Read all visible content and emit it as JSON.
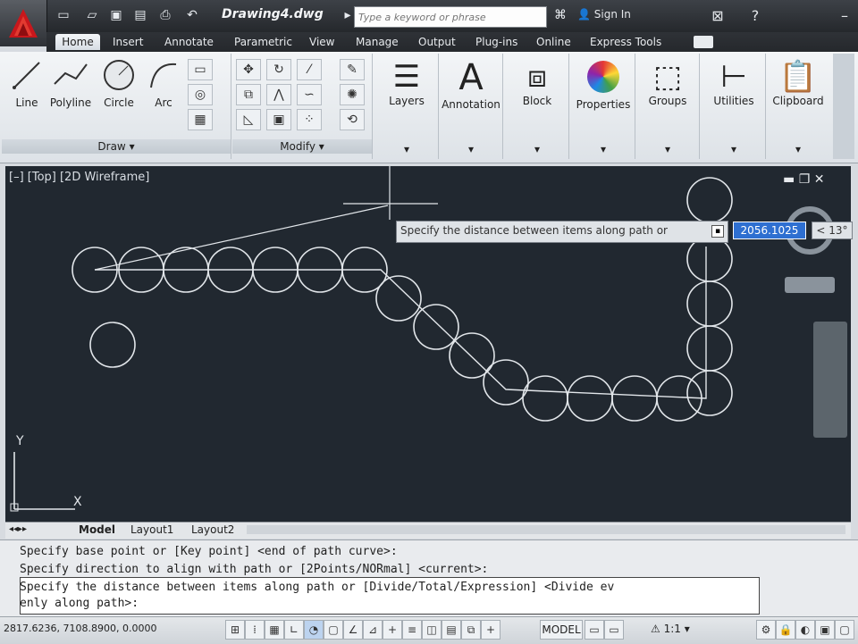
{
  "window": {
    "doc_title": "Drawing4.dwg",
    "search_placeholder": "Type a keyword or phrase",
    "signin_label": "Sign In"
  },
  "tabs": [
    "Home",
    "Insert",
    "Annotate",
    "Parametric",
    "View",
    "Manage",
    "Output",
    "Plug-ins",
    "Online",
    "Express Tools"
  ],
  "ribbon": {
    "draw_tools": [
      "Line",
      "Polyline",
      "Circle",
      "Arc"
    ],
    "draw_panel_label": "Draw",
    "modify_panel_label": "Modify",
    "panels": [
      "Layers",
      "Annotation",
      "Block",
      "Properties",
      "Groups",
      "Utilities",
      "Clipboard"
    ]
  },
  "viewport": {
    "label": "[–] [Top] [2D Wireframe]",
    "tooltip": "Specify the distance between items along path or",
    "distance_value": "2056.1025",
    "angle_value": "< 13°",
    "ucs_x": "X",
    "ucs_y": "Y"
  },
  "layout_tabs": [
    "Model",
    "Layout1",
    "Layout2"
  ],
  "command": {
    "history": [
      "Specify base point or [Key point] <end of path curve>:",
      "Specify direction to align with path or [2Points/NORmal] <current>:"
    ],
    "active_line1": "Specify the distance between items along path or [Divide/Total/Expression] <Divide ev",
    "active_line2": "enly along path>:"
  },
  "status": {
    "coords": "2817.6236, 7108.8900, 0.0000",
    "model_label": "MODEL",
    "scale_label": "1:1"
  },
  "colors": {
    "canvas_bg": "#212830",
    "geometry": "#e2e6ea",
    "active_input": "#2e6fd1"
  }
}
